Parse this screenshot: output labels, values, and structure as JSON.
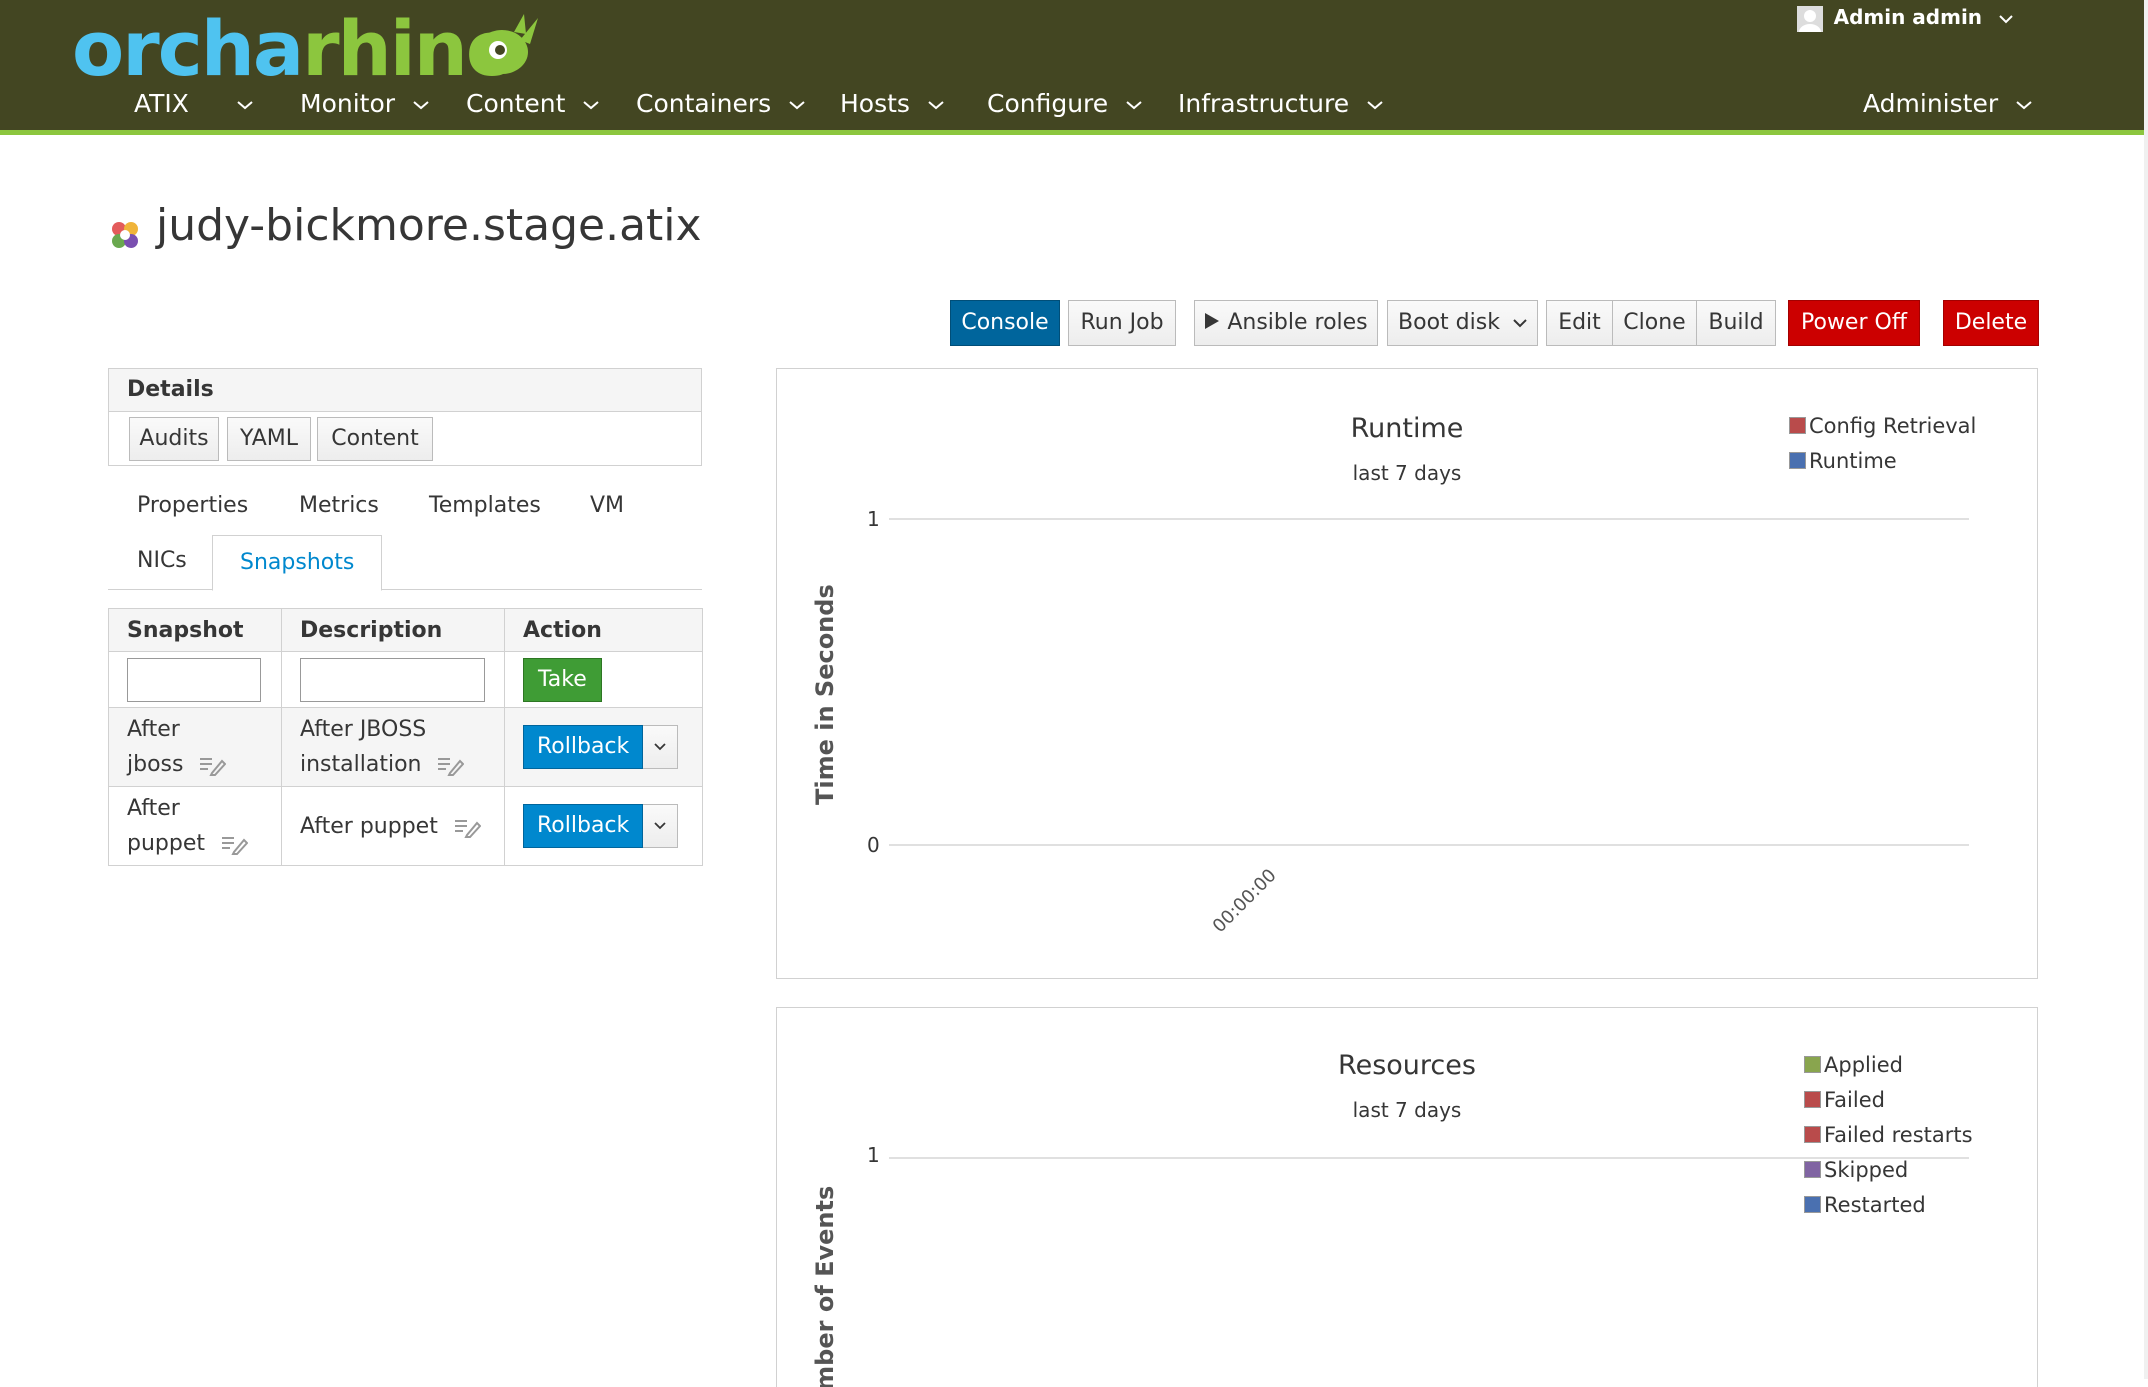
{
  "header": {
    "logo_part1": "orcha",
    "logo_part2": "rhino",
    "user": "Admin admin",
    "nav": [
      "ATIX",
      "Monitor",
      "Content",
      "Containers",
      "Hosts",
      "Configure",
      "Infrastructure",
      "Administer"
    ]
  },
  "page": {
    "title": "judy-bickmore.stage.atix"
  },
  "actions": {
    "console": "Console",
    "run_job": "Run Job",
    "ansible_roles": "Ansible roles",
    "boot_disk": "Boot disk",
    "edit": "Edit",
    "clone": "Clone",
    "build": "Build",
    "power_off": "Power Off",
    "delete": "Delete"
  },
  "details": {
    "heading": "Details",
    "buttons": [
      "Audits",
      "YAML",
      "Content"
    ]
  },
  "tabs": [
    "Properties",
    "Metrics",
    "Templates",
    "VM",
    "NICs",
    "Snapshots"
  ],
  "snapshots": {
    "headers": [
      "Snapshot",
      "Description",
      "Action"
    ],
    "take_label": "Take",
    "rows": [
      {
        "name_line1": "After",
        "name_line2": "jboss",
        "desc_line1": "After JBOSS",
        "desc_line2": "installation",
        "action": "Rollback"
      },
      {
        "name_line1": "After",
        "name_line2": "puppet",
        "desc_line1": "After puppet",
        "desc_line2": "",
        "action": "Rollback"
      }
    ]
  },
  "charts": {
    "runtime": {
      "title": "Runtime",
      "subtitle": "last 7 days",
      "ylabel": "Time in Seconds",
      "y_ticks": [
        "1",
        "0"
      ],
      "x_tick": "00:00:00",
      "legend": [
        {
          "label": "Config Retrieval",
          "color": "#b94b4b"
        },
        {
          "label": "Runtime",
          "color": "#4a70b0"
        }
      ]
    },
    "resources": {
      "title": "Resources",
      "subtitle": "last 7 days",
      "ylabel": "Number of Events",
      "y_ticks": [
        "1"
      ],
      "legend": [
        {
          "label": "Applied",
          "color": "#89a54e"
        },
        {
          "label": "Failed",
          "color": "#b94b4b"
        },
        {
          "label": "Failed restarts",
          "color": "#b94b4b"
        },
        {
          "label": "Skipped",
          "color": "#8064a2"
        },
        {
          "label": "Restarted",
          "color": "#4a70b0"
        }
      ]
    }
  },
  "chart_data": [
    {
      "type": "line",
      "title": "Runtime",
      "subtitle": "last 7 days",
      "ylabel": "Time in Seconds",
      "xlabel": "",
      "ylim": [
        0,
        1
      ],
      "x": [
        "00:00:00"
      ],
      "series": [
        {
          "name": "Config Retrieval",
          "values": []
        },
        {
          "name": "Runtime",
          "values": []
        }
      ],
      "legend": "top-right"
    },
    {
      "type": "line",
      "title": "Resources",
      "subtitle": "last 7 days",
      "ylabel": "Number of Events",
      "xlabel": "",
      "series": [
        {
          "name": "Applied",
          "values": []
        },
        {
          "name": "Failed",
          "values": []
        },
        {
          "name": "Failed restarts",
          "values": []
        },
        {
          "name": "Skipped",
          "values": []
        },
        {
          "name": "Restarted",
          "values": []
        }
      ],
      "legend": "top-right"
    }
  ]
}
